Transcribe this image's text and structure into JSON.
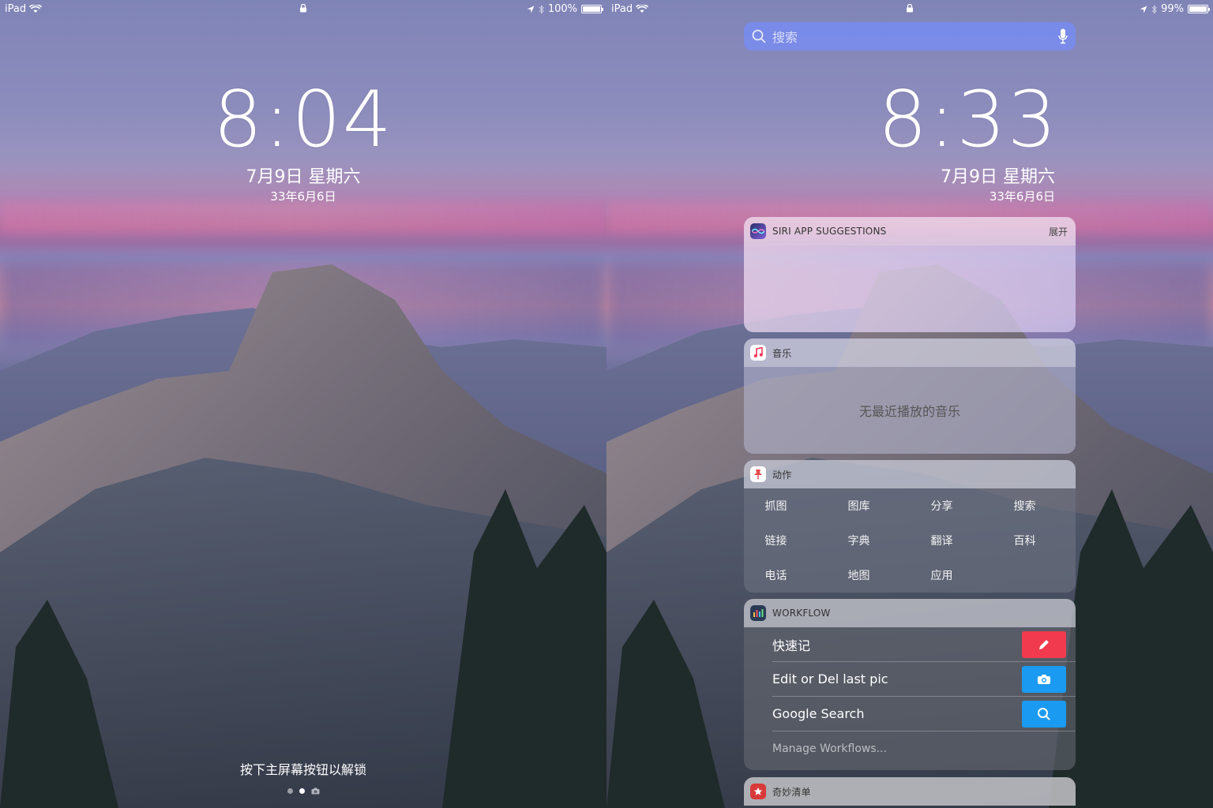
{
  "left_screen": {
    "status": {
      "carrier": "iPad",
      "battery_text": "100%",
      "battery_level": 1.0
    },
    "clock": "8:04",
    "date": "7月9日 星期六",
    "lunar": "33年6月6日",
    "unlock_hint": "按下主屏幕按钮以解锁",
    "page_dots": {
      "count": 3,
      "active_index": 1
    }
  },
  "right_screen": {
    "status": {
      "carrier": "iPad",
      "battery_text": "99%",
      "battery_level": 0.99
    },
    "search": {
      "placeholder": "搜索"
    },
    "clock": "8:33",
    "date": "7月9日 星期六",
    "lunar": "33年6月6日",
    "siri_widget": {
      "title": "SIRI APP SUGGESTIONS",
      "expand_label": "展开"
    },
    "music_widget": {
      "title": "音乐",
      "empty_text": "无最近播放的音乐"
    },
    "actions_widget": {
      "title": "动作",
      "items": [
        "抓图",
        "图库",
        "分享",
        "搜索",
        "链接",
        "字典",
        "翻译",
        "百科",
        "电话",
        "地图",
        "应用"
      ]
    },
    "workflow_widget": {
      "title": "WORKFLOW",
      "items": [
        {
          "label": "快速记",
          "icon": "pencil-icon",
          "color": "#f23a4e"
        },
        {
          "label": "Edit or Del last pic",
          "icon": "camera-icon",
          "color": "#1b9af1"
        },
        {
          "label": "Google Search",
          "icon": "search-icon",
          "color": "#1b9af1"
        }
      ],
      "manage_label": "Manage Workflows..."
    },
    "miao_widget": {
      "title": "奇妙清单"
    }
  },
  "colors": {
    "search_bar": "#7890f0",
    "wf_red": "#f23a4e",
    "wf_blue": "#1b9af1"
  }
}
